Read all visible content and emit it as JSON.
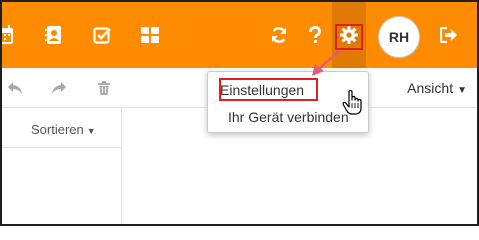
{
  "header": {
    "avatar_initials": "RH",
    "icons": [
      "calendar-icon",
      "contacts-icon",
      "tasks-icon",
      "apps-grid-icon",
      "refresh-icon",
      "help-icon",
      "gear-icon",
      "logout-icon"
    ]
  },
  "toolbar": {
    "icons": [
      "reply-icon",
      "forward-icon",
      "trash-icon"
    ],
    "view_label": "Ansicht"
  },
  "list": {
    "sort_label": "Sortieren"
  },
  "settings_menu": {
    "items": [
      "Einstellungen",
      "Ihr Gerät verbinden"
    ],
    "highlighted": "Einstellungen"
  },
  "colors": {
    "brand_orange": "#ff8c00",
    "annotation_red": "#e02020",
    "annotation_pink": "#e8587a"
  }
}
